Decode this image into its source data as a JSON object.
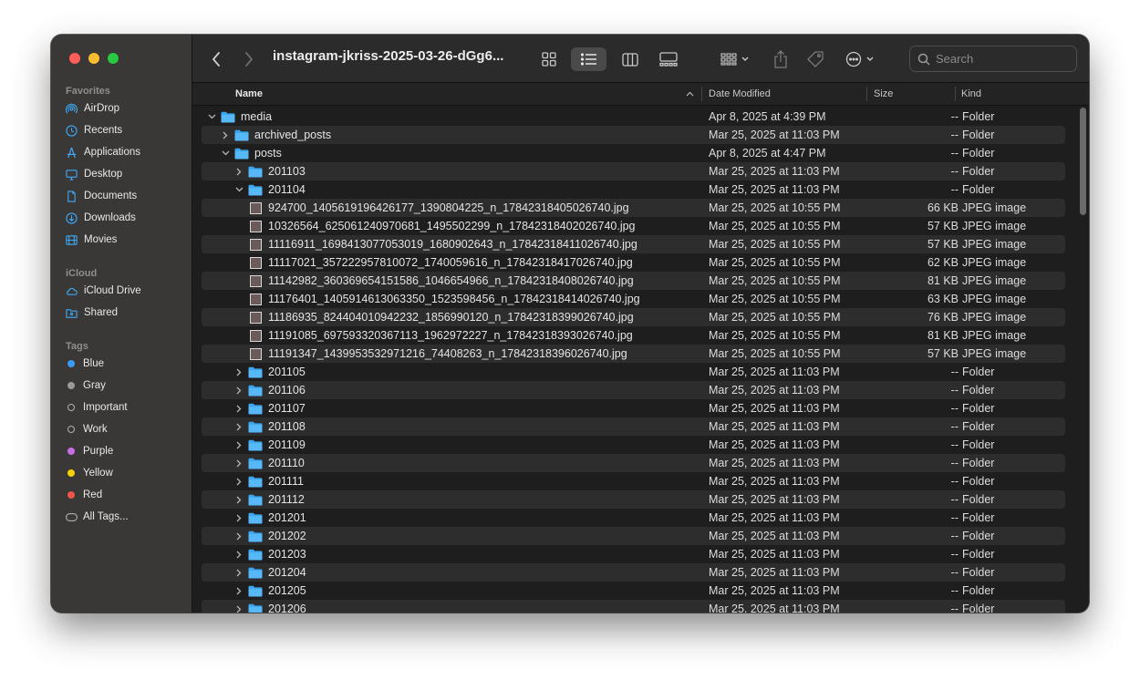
{
  "window": {
    "title": "instagram-jkriss-2025-03-26-dGg6..."
  },
  "search": {
    "placeholder": "Search"
  },
  "sidebar": {
    "favorites_label": "Favorites",
    "favorites": [
      {
        "label": "AirDrop",
        "icon": "airdrop-icon"
      },
      {
        "label": "Recents",
        "icon": "clock-icon"
      },
      {
        "label": "Applications",
        "icon": "applications-icon"
      },
      {
        "label": "Desktop",
        "icon": "desktop-icon"
      },
      {
        "label": "Documents",
        "icon": "document-icon"
      },
      {
        "label": "Downloads",
        "icon": "download-icon"
      },
      {
        "label": "Movies",
        "icon": "film-icon"
      }
    ],
    "icloud_label": "iCloud",
    "icloud": [
      {
        "label": "iCloud Drive",
        "icon": "cloud-icon"
      },
      {
        "label": "Shared",
        "icon": "shared-folder-icon"
      }
    ],
    "tags_label": "Tags",
    "tags": [
      {
        "label": "Blue",
        "color": "#3b9cf5"
      },
      {
        "label": "Gray",
        "color": "#9a9a9a"
      },
      {
        "label": "Important",
        "color": "outline"
      },
      {
        "label": "Work",
        "color": "outline"
      },
      {
        "label": "Purple",
        "color": "#c86ee6"
      },
      {
        "label": "Yellow",
        "color": "#f5d20a"
      },
      {
        "label": "Red",
        "color": "#f0554b"
      },
      {
        "label": "All Tags...",
        "color": "alltags"
      }
    ]
  },
  "columns": {
    "name": "Name",
    "date": "Date Modified",
    "size": "Size",
    "kind": "Kind"
  },
  "rows": [
    {
      "name": "media",
      "date": "Apr 8, 2025 at 4:39 PM",
      "size": "--",
      "kind": "Folder",
      "type": "folder",
      "depth": 0,
      "expanded": true
    },
    {
      "name": "archived_posts",
      "date": "Mar 25, 2025 at 11:03 PM",
      "size": "--",
      "kind": "Folder",
      "type": "folder",
      "depth": 1,
      "expanded": false
    },
    {
      "name": "posts",
      "date": "Apr 8, 2025 at 4:47 PM",
      "size": "--",
      "kind": "Folder",
      "type": "folder",
      "depth": 1,
      "expanded": true
    },
    {
      "name": "201103",
      "date": "Mar 25, 2025 at 11:03 PM",
      "size": "--",
      "kind": "Folder",
      "type": "folder",
      "depth": 2,
      "expanded": false
    },
    {
      "name": "201104",
      "date": "Mar 25, 2025 at 11:03 PM",
      "size": "--",
      "kind": "Folder",
      "type": "folder",
      "depth": 2,
      "expanded": true
    },
    {
      "name": "924700_1405619196426177_1390804225_n_17842318405026740.jpg",
      "date": "Mar 25, 2025 at 10:55 PM",
      "size": "66 KB",
      "kind": "JPEG image",
      "type": "file",
      "depth": 3
    },
    {
      "name": "10326564_625061240970681_1495502299_n_17842318402026740.jpg",
      "date": "Mar 25, 2025 at 10:55 PM",
      "size": "57 KB",
      "kind": "JPEG image",
      "type": "file",
      "depth": 3
    },
    {
      "name": "11116911_1698413077053019_1680902643_n_17842318411026740.jpg",
      "date": "Mar 25, 2025 at 10:55 PM",
      "size": "57 KB",
      "kind": "JPEG image",
      "type": "file",
      "depth": 3
    },
    {
      "name": "11117021_357222957810072_1740059616_n_17842318417026740.jpg",
      "date": "Mar 25, 2025 at 10:55 PM",
      "size": "62 KB",
      "kind": "JPEG image",
      "type": "file",
      "depth": 3
    },
    {
      "name": "11142982_360369654151586_1046654966_n_17842318408026740.jpg",
      "date": "Mar 25, 2025 at 10:55 PM",
      "size": "81 KB",
      "kind": "JPEG image",
      "type": "file",
      "depth": 3
    },
    {
      "name": "11176401_1405914613063350_1523598456_n_17842318414026740.jpg",
      "date": "Mar 25, 2025 at 10:55 PM",
      "size": "63 KB",
      "kind": "JPEG image",
      "type": "file",
      "depth": 3
    },
    {
      "name": "11186935_824404010942232_1856990120_n_17842318399026740.jpg",
      "date": "Mar 25, 2025 at 10:55 PM",
      "size": "76 KB",
      "kind": "JPEG image",
      "type": "file",
      "depth": 3
    },
    {
      "name": "11191085_697593320367113_1962972227_n_17842318393026740.jpg",
      "date": "Mar 25, 2025 at 10:55 PM",
      "size": "81 KB",
      "kind": "JPEG image",
      "type": "file",
      "depth": 3
    },
    {
      "name": "11191347_1439953532971216_74408263_n_17842318396026740.jpg",
      "date": "Mar 25, 2025 at 10:55 PM",
      "size": "57 KB",
      "kind": "JPEG image",
      "type": "file",
      "depth": 3
    },
    {
      "name": "201105",
      "date": "Mar 25, 2025 at 11:03 PM",
      "size": "--",
      "kind": "Folder",
      "type": "folder",
      "depth": 2,
      "expanded": false
    },
    {
      "name": "201106",
      "date": "Mar 25, 2025 at 11:03 PM",
      "size": "--",
      "kind": "Folder",
      "type": "folder",
      "depth": 2,
      "expanded": false
    },
    {
      "name": "201107",
      "date": "Mar 25, 2025 at 11:03 PM",
      "size": "--",
      "kind": "Folder",
      "type": "folder",
      "depth": 2,
      "expanded": false
    },
    {
      "name": "201108",
      "date": "Mar 25, 2025 at 11:03 PM",
      "size": "--",
      "kind": "Folder",
      "type": "folder",
      "depth": 2,
      "expanded": false
    },
    {
      "name": "201109",
      "date": "Mar 25, 2025 at 11:03 PM",
      "size": "--",
      "kind": "Folder",
      "type": "folder",
      "depth": 2,
      "expanded": false
    },
    {
      "name": "201110",
      "date": "Mar 25, 2025 at 11:03 PM",
      "size": "--",
      "kind": "Folder",
      "type": "folder",
      "depth": 2,
      "expanded": false
    },
    {
      "name": "201111",
      "date": "Mar 25, 2025 at 11:03 PM",
      "size": "--",
      "kind": "Folder",
      "type": "folder",
      "depth": 2,
      "expanded": false
    },
    {
      "name": "201112",
      "date": "Mar 25, 2025 at 11:03 PM",
      "size": "--",
      "kind": "Folder",
      "type": "folder",
      "depth": 2,
      "expanded": false
    },
    {
      "name": "201201",
      "date": "Mar 25, 2025 at 11:03 PM",
      "size": "--",
      "kind": "Folder",
      "type": "folder",
      "depth": 2,
      "expanded": false
    },
    {
      "name": "201202",
      "date": "Mar 25, 2025 at 11:03 PM",
      "size": "--",
      "kind": "Folder",
      "type": "folder",
      "depth": 2,
      "expanded": false
    },
    {
      "name": "201203",
      "date": "Mar 25, 2025 at 11:03 PM",
      "size": "--",
      "kind": "Folder",
      "type": "folder",
      "depth": 2,
      "expanded": false
    },
    {
      "name": "201204",
      "date": "Mar 25, 2025 at 11:03 PM",
      "size": "--",
      "kind": "Folder",
      "type": "folder",
      "depth": 2,
      "expanded": false
    },
    {
      "name": "201205",
      "date": "Mar 25, 2025 at 11:03 PM",
      "size": "--",
      "kind": "Folder",
      "type": "folder",
      "depth": 2,
      "expanded": false
    },
    {
      "name": "201206",
      "date": "Mar 25, 2025 at 11:03 PM",
      "size": "--",
      "kind": "Folder",
      "type": "folder",
      "depth": 2,
      "expanded": false
    }
  ],
  "colors": {
    "folder": "#3aa7f0",
    "accent": "#0a84ff"
  }
}
